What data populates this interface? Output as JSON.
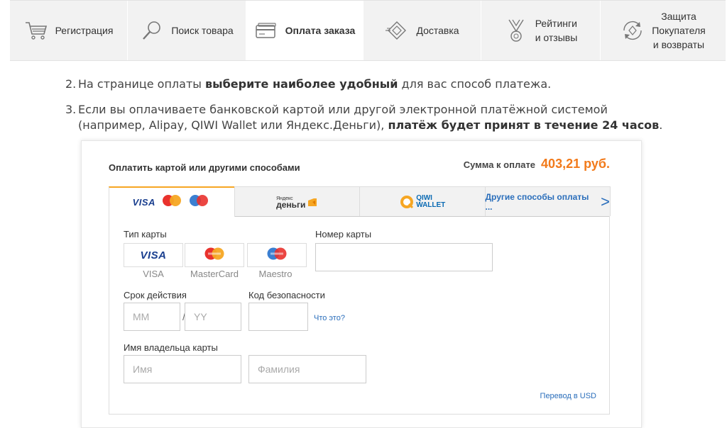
{
  "nav": {
    "items": [
      {
        "label": "Регистрация",
        "icon": "cart-icon"
      },
      {
        "label": "Поиск товара",
        "icon": "magnifier-icon"
      },
      {
        "label": "Оплата заказа",
        "icon": "card-icon",
        "active": true
      },
      {
        "label": "Доставка",
        "icon": "delivery-icon"
      },
      {
        "label_line1": "Рейтинги",
        "label_line2": "и отзывы",
        "icon": "medal-icon"
      },
      {
        "label_line1": "Защита",
        "label_line2": "Покупателя",
        "label_line3": "и возвраты",
        "icon": "refresh-shield-icon"
      }
    ]
  },
  "steps": [
    {
      "num": "2.",
      "pre": "На странице оплаты ",
      "bold": "выберите наиболее удобный",
      "post": " для вас способ платежа."
    },
    {
      "num": "3.",
      "pre": "Если вы оплачиваете банковской картой или другой электронной платёжной системой (например, Alipay, QIWI Wallet или Яндекс.Деньги), ",
      "bold": "платёж будет принят в течение 24 часов",
      "post": "."
    }
  ],
  "widget": {
    "title": "Оплатить картой или другими способами",
    "sum_label": "Сумма к оплате",
    "sum_value": "403,21 руб.",
    "tabs": {
      "cards_visa": "VISA",
      "yandex_small": "Яндекс",
      "yandex_big": "деньги",
      "qiwi_line1": "QIWI",
      "qiwi_line2": "WALLET",
      "other": "Другие способы оплаты ...",
      "other_arrow": ">"
    },
    "card_type_label": "Тип карты",
    "card_types": [
      {
        "logo": "VISA",
        "caption": "VISA"
      },
      {
        "logo": "mastercard",
        "caption": "MasterCard"
      },
      {
        "logo": "maestro",
        "caption": "Maestro"
      }
    ],
    "card_number_label": "Номер карты",
    "card_number_value": "",
    "expiry_label": "Срок действия",
    "expiry_mm_placeholder": "MM",
    "expiry_yy_placeholder": "YY",
    "expiry_separator": "/",
    "cvc_label": "Код безопасности",
    "cvc_value": "",
    "cvc_help": "Что это?",
    "holder_label": "Имя владельца карты",
    "holder_first_placeholder": "Имя",
    "holder_last_placeholder": "Фамилия",
    "usd_link": "Перевод в USD"
  },
  "colors": {
    "accent_orange": "#f27a1a",
    "link_blue": "#2a6ebb",
    "nav_bg": "#f2f2f2"
  }
}
